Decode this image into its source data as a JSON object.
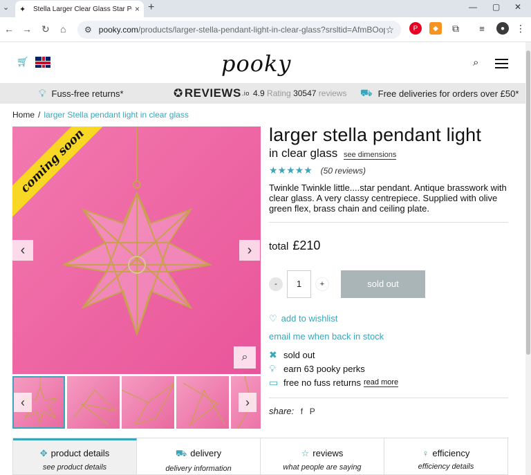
{
  "browser": {
    "tab_title": "Stella Larger Clear Glass Star Pe",
    "url_host": "pooky.com",
    "url_path": "/products/larger-stella-pendant-light-in-clear-glass?srsltid=AfmBOop...",
    "new_tab": "+",
    "close_tab": "×"
  },
  "header": {
    "logo": "pooky"
  },
  "infobar": {
    "returns": "Fuss-free returns*",
    "reviews_brand": "REVIEWS",
    "reviews_suffix": ".io",
    "rating_value": "4.9",
    "rating_label": "Rating",
    "reviews_count": "30547",
    "reviews_label": "reviews",
    "delivery": "Free deliveries for orders over £50*"
  },
  "breadcrumb": {
    "home": "Home",
    "separator": "/",
    "current": "larger Stella pendant light in clear glass"
  },
  "gallery": {
    "ribbon": "coming soon"
  },
  "product": {
    "title": "larger stella pendant light",
    "subtitle": "in clear glass",
    "see_dimensions": "see dimensions",
    "stars": "★★★★★",
    "rating_stars": 5,
    "reviews": "(50 reviews)",
    "description": "Twinkle Twinkle little....star pendant. Antique brasswork with clear glass. A very classy centrepiece. Supplied with olive green flex, brass chain and ceiling plate.",
    "total_label": "total",
    "price": "£210",
    "qty_minus": "-",
    "qty": "1",
    "qty_plus": "+",
    "sold_out_button": "sold out",
    "wishlist": "add to wishlist",
    "email_stock": "email me when back in stock",
    "status_sold_out": "sold out",
    "perks": "earn 63 pooky perks",
    "returns": "free no fuss returns",
    "read_more": "read more",
    "share_label": "share:",
    "share_facebook": "f",
    "share_pinterest": "P"
  },
  "tabs": [
    {
      "label": "product details",
      "sub": "see product details",
      "icon": "move-icon"
    },
    {
      "label": "delivery",
      "sub": "delivery information",
      "icon": "truck-icon"
    },
    {
      "label": "reviews",
      "sub": "what people are saying",
      "icon": "star-icon"
    },
    {
      "label": "efficiency",
      "sub": "efficiency details",
      "icon": "bulb-icon"
    }
  ],
  "colors": {
    "accent": "#3aa6b9",
    "pink_bg": "#ef6aa6",
    "ribbon": "#f8d825",
    "sold_out_btn": "#a9b5b6"
  }
}
